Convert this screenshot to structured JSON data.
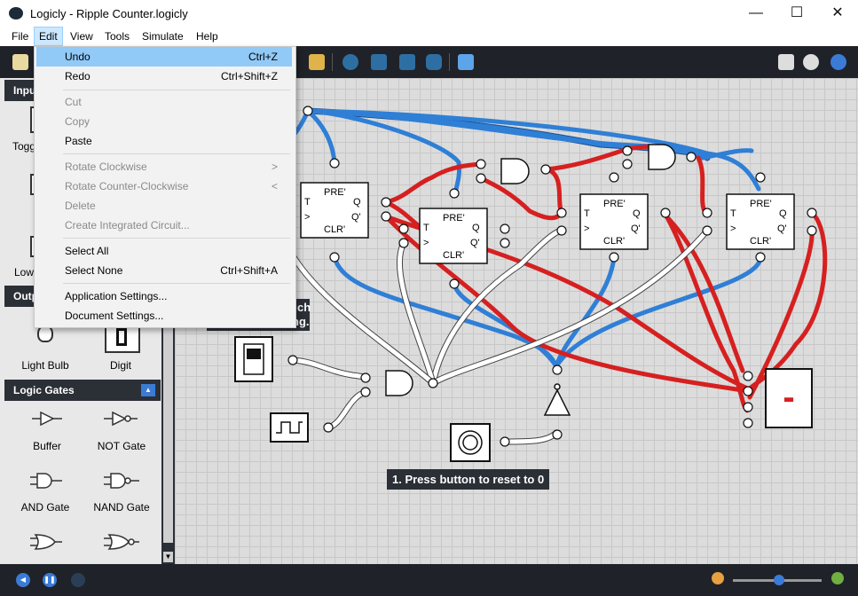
{
  "window": {
    "title": "Logicly - Ripple Counter.logicly",
    "minimize": "—",
    "maximize": "☐",
    "close": "✕"
  },
  "menubar": {
    "items": [
      "File",
      "Edit",
      "View",
      "Tools",
      "Simulate",
      "Help"
    ]
  },
  "edit_menu": {
    "items": [
      {
        "label": "Undo",
        "shortcut": "Ctrl+Z"
      },
      {
        "label": "Redo",
        "shortcut": "Ctrl+Shift+Z"
      },
      {
        "label": "Cut",
        "shortcut": ""
      },
      {
        "label": "Copy",
        "shortcut": ""
      },
      {
        "label": "Paste",
        "shortcut": ""
      },
      {
        "label": "Rotate Clockwise",
        "shortcut": ">"
      },
      {
        "label": "Rotate Counter-Clockwise",
        "shortcut": "<"
      },
      {
        "label": "Delete",
        "shortcut": ""
      },
      {
        "label": "Create Integrated Circuit...",
        "shortcut": ""
      },
      {
        "label": "Select All",
        "shortcut": ""
      },
      {
        "label": "Select None",
        "shortcut": "Ctrl+Shift+A"
      },
      {
        "label": "Application Settings...",
        "shortcut": ""
      },
      {
        "label": "Document Settings...",
        "shortcut": ""
      }
    ]
  },
  "sidebar": {
    "inputs_header": "Inpu",
    "outputs_header": "Outp",
    "partial_labels": {
      "toggle": "Togg",
      "low": "Low"
    },
    "outputs": [
      {
        "label": "Light Bulb"
      },
      {
        "label": "Digit"
      }
    ],
    "logic_gates_header": "Logic Gates",
    "gates": [
      {
        "label": "Buffer"
      },
      {
        "label": "NOT Gate"
      },
      {
        "label": "AND Gate"
      },
      {
        "label": "NAND Gate"
      }
    ]
  },
  "canvas": {
    "flipflop": {
      "pre": "PRE'",
      "clr": "CLR'",
      "t": "T",
      "clk": ">",
      "q": "Q",
      "qn": "Q'"
    },
    "note_reset": "1. Press button to reset to 0",
    "note_partial_1": "ch",
    "note_partial_2": "ng.",
    "digit_display": "-"
  },
  "colors": {
    "wire_high": "#d62020",
    "wire_low": "#2f7fd6",
    "wire_neutral": "#ffffff",
    "accent": "#3b7bd6"
  }
}
